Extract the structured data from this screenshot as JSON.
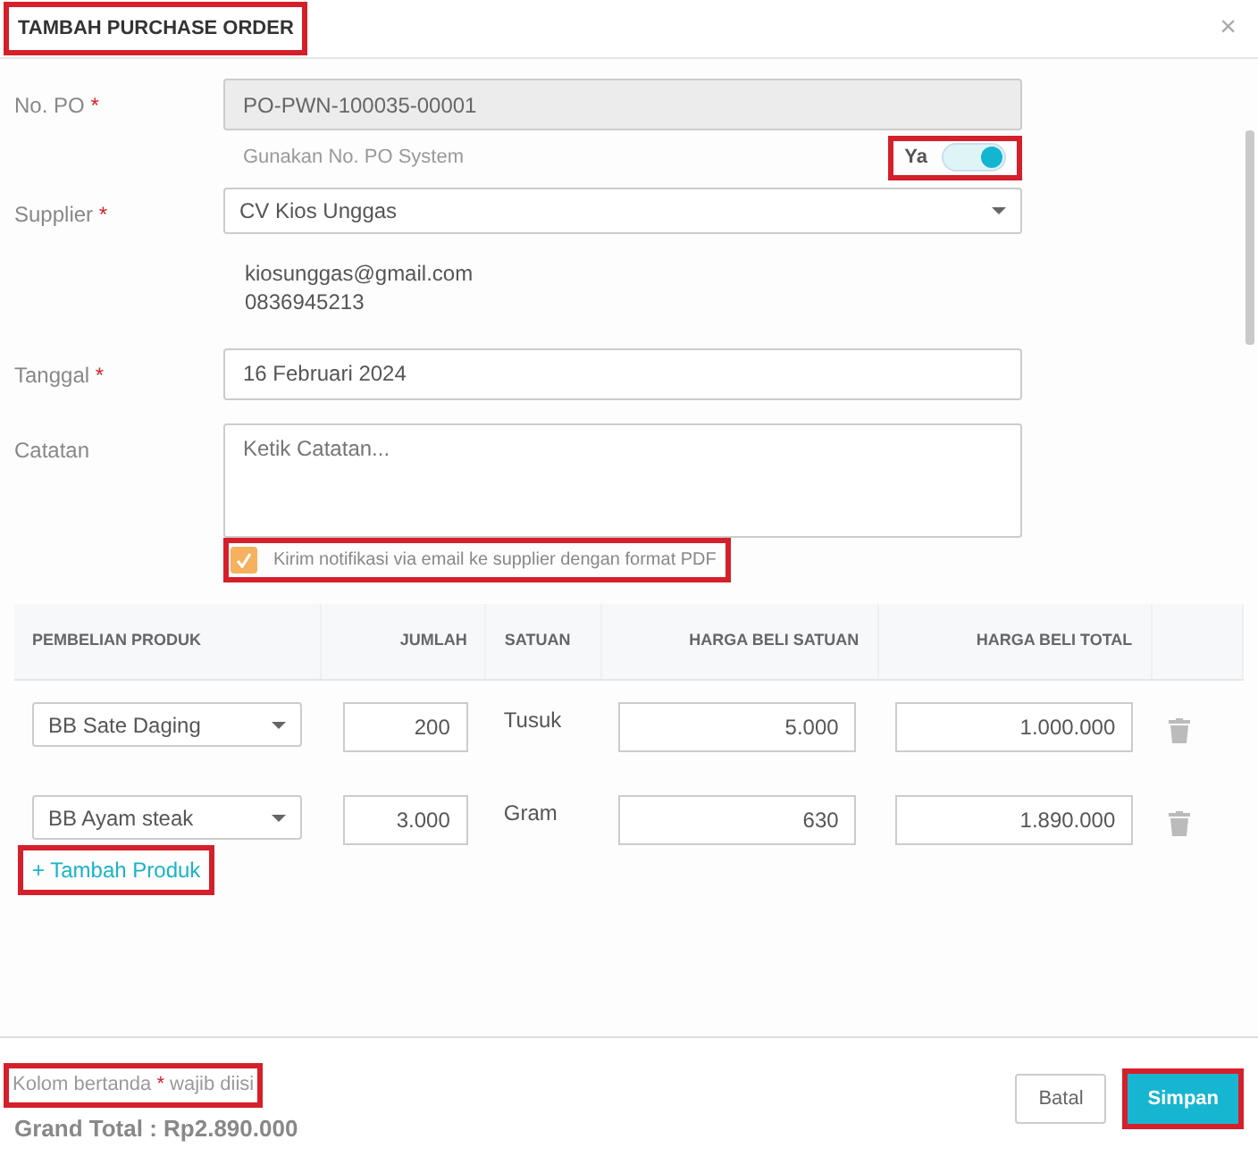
{
  "dialog": {
    "title": "TAMBAH PURCHASE ORDER",
    "highlighted": true,
    "close": "×"
  },
  "po_number": {
    "label": "No. PO",
    "mark": "*",
    "value": "PO-PWN-100035-00001",
    "disabled": true
  },
  "po_system": {
    "hint": "Gunakan No. PO System",
    "toggle_label": "Ya",
    "on": true,
    "highlighted": true
  },
  "supplier": {
    "label": "Supplier",
    "mark": "*",
    "value": "CV Kios Unggas",
    "contact": [
      "kiosunggas@gmail.com",
      "0836945213"
    ]
  },
  "date": {
    "label": "Tanggal",
    "mark": "*",
    "value": "16 Februari 2024"
  },
  "notes": {
    "label": "Catatan",
    "placeholder": "Ketik Catatan..."
  },
  "notify": {
    "label": "Kirim notifikasi via email ke supplier dengan format PDF",
    "checked": true,
    "highlighted": true
  },
  "table": {
    "columns": [
      "PEMBELIAN PRODUK",
      "JUMLAH",
      "SATUAN",
      "HARGA BELI SATUAN",
      "HARGA BELI TOTAL"
    ],
    "rows": [
      {
        "product": "BB Sate Daging",
        "quantity": "200",
        "unit": "Tusuk",
        "unit_price": "5.000",
        "total": "1.000.000"
      },
      {
        "product": "BB Ayam steak",
        "quantity": "3.000",
        "unit": "Gram",
        "unit_price": "630",
        "total": "1.890.000"
      }
    ]
  },
  "add_product": {
    "label": "+ Tambah Produk",
    "highlighted": true
  },
  "footer": {
    "required_note": {
      "before": "Kolom bertanda",
      "mark": "*",
      "after": "wajib diisi",
      "highlighted": true
    },
    "grand_total": "Grand Total : Rp2.890.000",
    "buttons": [
      {
        "label": "Batal",
        "kind": "secondary",
        "highlighted": false
      },
      {
        "label": "Simpan",
        "kind": "primary",
        "highlighted": true
      }
    ]
  }
}
